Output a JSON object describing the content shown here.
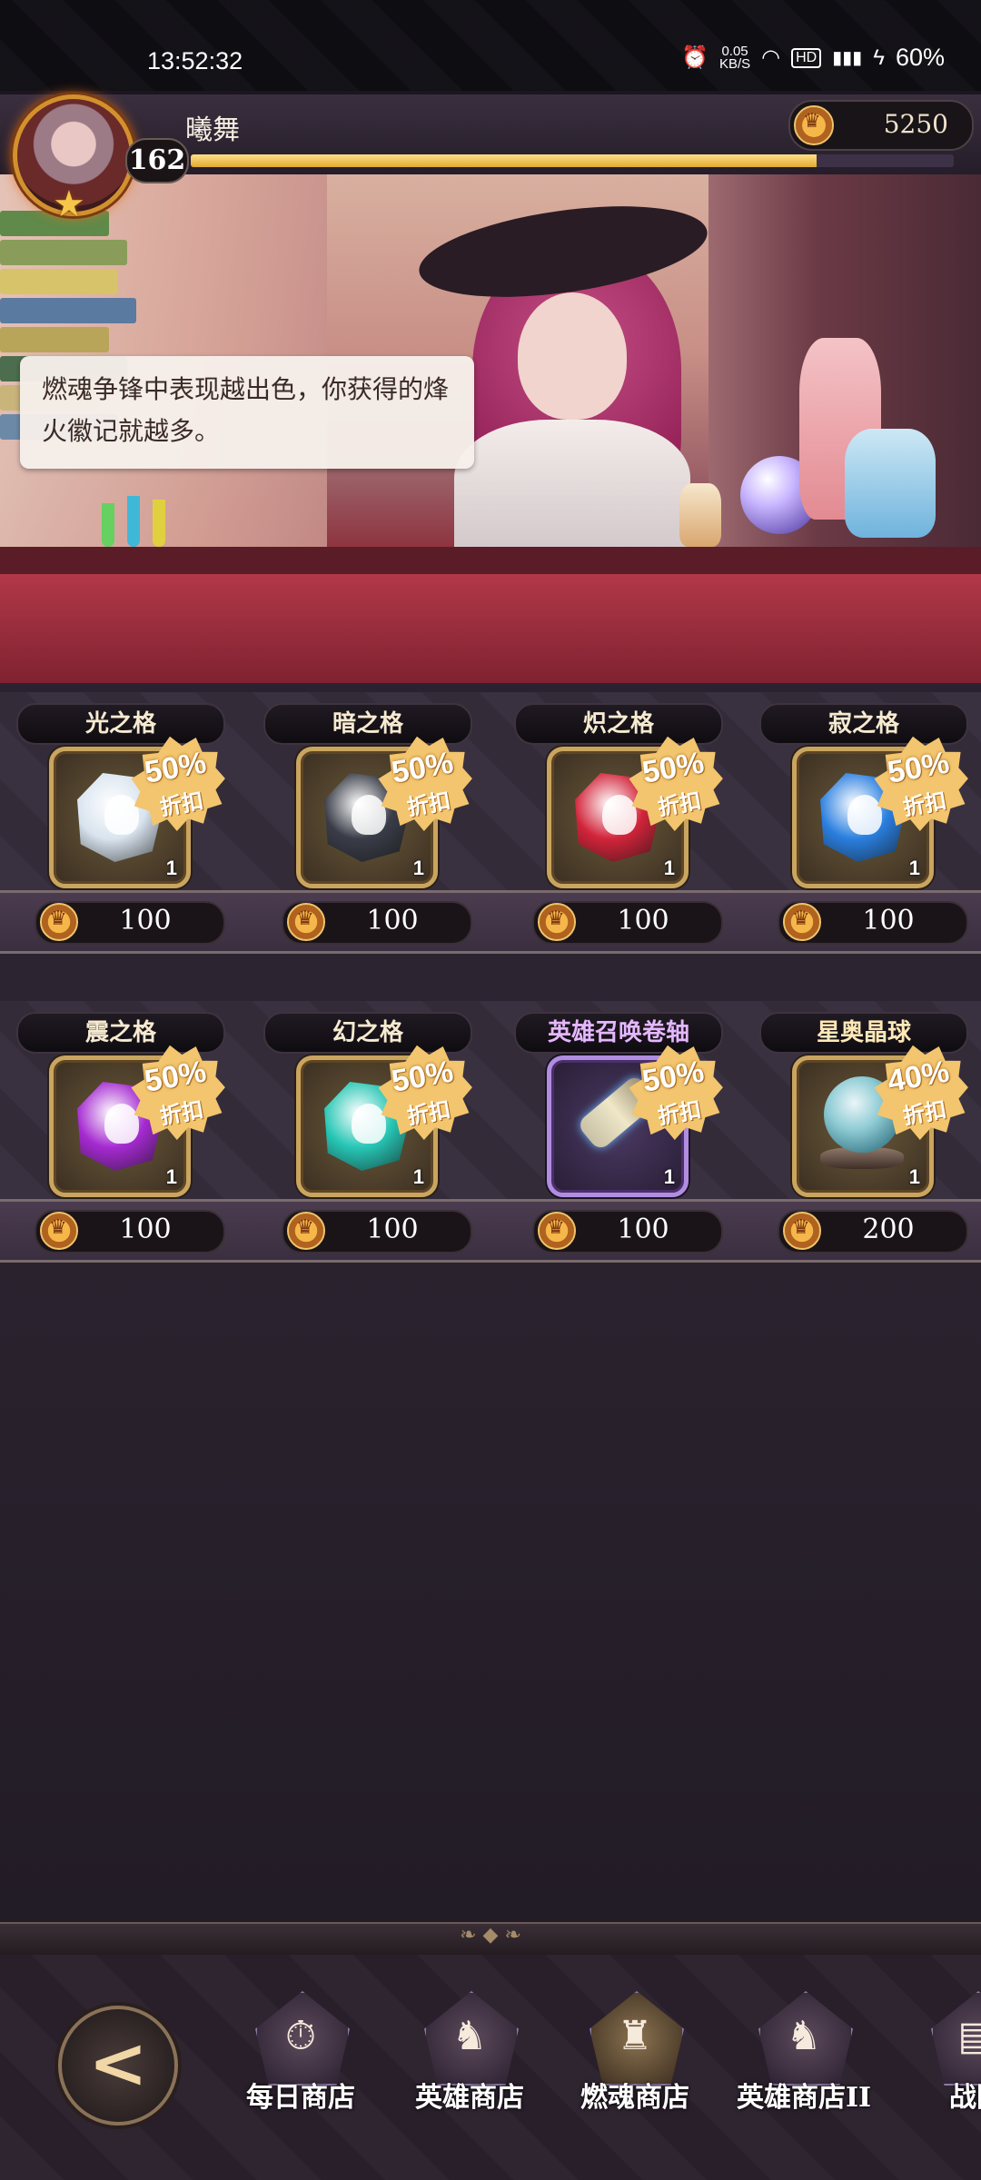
{
  "status_bar": {
    "time": "13:52:32",
    "net_speed": "0.05",
    "net_unit": "KB/S",
    "battery": "60%",
    "icons": [
      "alarm-icon",
      "wifi-icon",
      "hd-icon",
      "signal-4g-icon",
      "charging-icon"
    ]
  },
  "player": {
    "name": "曦舞",
    "level": "162",
    "xp_fraction": 0.82,
    "currency_amount": "5250"
  },
  "speech": "燃魂争锋中表现越出色，你获得的烽火徽记就越多。",
  "shop": {
    "rows": [
      [
        {
          "name": "光之格",
          "discount": "50%",
          "discount_label": "折扣",
          "qty": "1",
          "price": "100",
          "icon": "light-gem-icon",
          "color": "#d9e4ef"
        },
        {
          "name": "暗之格",
          "discount": "50%",
          "discount_label": "折扣",
          "qty": "1",
          "price": "100",
          "icon": "dark-gem-icon",
          "color": "#3a3d48"
        },
        {
          "name": "炽之格",
          "discount": "50%",
          "discount_label": "折扣",
          "qty": "1",
          "price": "100",
          "icon": "fire-gem-icon",
          "color": "#d2243a"
        },
        {
          "name": "寂之格",
          "discount": "50%",
          "discount_label": "折扣",
          "qty": "1",
          "price": "100",
          "icon": "ice-gem-icon",
          "color": "#2a7fe0"
        }
      ],
      [
        {
          "name": "震之格",
          "discount": "50%",
          "discount_label": "折扣",
          "qty": "1",
          "price": "100",
          "icon": "thunder-gem-icon",
          "color": "#a52ad1"
        },
        {
          "name": "幻之格",
          "discount": "50%",
          "discount_label": "折扣",
          "qty": "1",
          "price": "100",
          "icon": "illusion-gem-icon",
          "color": "#27c6b5"
        },
        {
          "name": "英雄召唤卷轴",
          "discount": "50%",
          "discount_label": "折扣",
          "qty": "1",
          "price": "100",
          "icon": "summon-scroll-icon",
          "color": "#c8c1a6"
        },
        {
          "name": "星奥晶球",
          "discount": "40%",
          "discount_label": "折扣",
          "qty": "1",
          "price": "200",
          "icon": "star-crystal-orb-icon",
          "color": "#8ecbd4"
        }
      ]
    ]
  },
  "nav": {
    "back_label": "back",
    "tabs": [
      {
        "label": "每日商店",
        "icon": "daily-shop-icon",
        "active": false
      },
      {
        "label": "英雄商店",
        "icon": "hero-shop-icon",
        "active": false
      },
      {
        "label": "燃魂商店",
        "icon": "soul-shop-icon",
        "active": true
      },
      {
        "label": "英雄商店II",
        "icon": "hero-shop-2-icon",
        "active": false
      },
      {
        "label": "战团",
        "icon": "guild-shop-icon",
        "active": false
      }
    ]
  }
}
